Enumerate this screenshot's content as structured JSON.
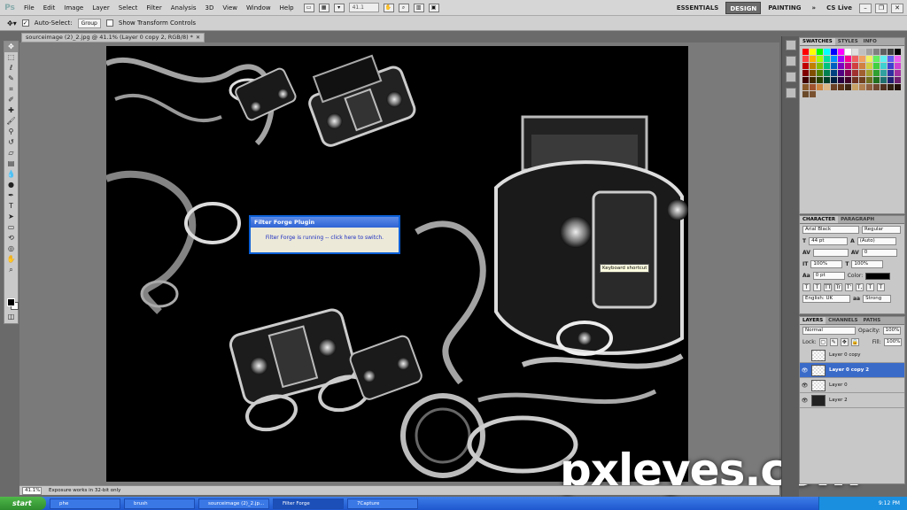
{
  "menubar": {
    "logo": "Ps",
    "items": [
      "File",
      "Edit",
      "Image",
      "Layer",
      "Select",
      "Filter",
      "Analysis",
      "3D",
      "View",
      "Window",
      "Help"
    ],
    "zoom": "41.1",
    "workspaces": [
      "ESSENTIALS",
      "DESIGN",
      "PAINTING"
    ],
    "more": "»",
    "cslive": "CS Live"
  },
  "optbar": {
    "auto_select_label": "Auto-Select:",
    "auto_select_value": "Group",
    "transform_label": "Show Transform Controls"
  },
  "document": {
    "tab_title": "sourceimage (2)_2.jpg @ 41.1% (Layer 0 copy 2, RGB/8) *",
    "status_zoom": "41.1%",
    "status_info": "Exposure works in 32-bit only"
  },
  "dialog": {
    "title": "Filter Forge Plugin",
    "message": "Filter Forge is running -- click here to switch."
  },
  "tooltip": "Keyboard shortcut",
  "watermark": "pxleyes.com",
  "swatches_panel": {
    "tabs": [
      "SWATCHES",
      "STYLES",
      "INFO"
    ],
    "colors": [
      "#ff0000",
      "#ffff00",
      "#00ff00",
      "#00ffff",
      "#0000ff",
      "#ff00ff",
      "#ffffff",
      "#e0e0e0",
      "#c0c0c0",
      "#a0a0a0",
      "#808080",
      "#606060",
      "#404040",
      "#000000",
      "#ff4040",
      "#ffb000",
      "#a0ff00",
      "#00e0a0",
      "#0090ff",
      "#a000ff",
      "#ff0090",
      "#f06060",
      "#f0a060",
      "#f0f060",
      "#60f060",
      "#60f0f0",
      "#6060f0",
      "#f060f0",
      "#c00000",
      "#c08000",
      "#80c000",
      "#00c080",
      "#0060c0",
      "#8000c0",
      "#c00080",
      "#d04040",
      "#d08040",
      "#d0d040",
      "#40d040",
      "#40d0d0",
      "#4040d0",
      "#d040d0",
      "#800000",
      "#805000",
      "#508000",
      "#008050",
      "#004080",
      "#500080",
      "#800050",
      "#a03030",
      "#a06030",
      "#a0a030",
      "#30a030",
      "#30a0a0",
      "#3030a0",
      "#a030a0",
      "#400000",
      "#402800",
      "#284000",
      "#004028",
      "#002040",
      "#280040",
      "#400028",
      "#703020",
      "#704020",
      "#707020",
      "#207020",
      "#207070",
      "#202070",
      "#702070",
      "#8b5a2b",
      "#a0522d",
      "#cd853f",
      "#deb887",
      "#6b4226",
      "#5c3317",
      "#3b2412",
      "#c8a165",
      "#b08050",
      "#906040",
      "#704830",
      "#503020",
      "#302010",
      "#201008",
      "#6b4a2a",
      "#7a5230"
    ]
  },
  "character_panel": {
    "tabs": [
      "CHARACTER",
      "PARAGRAPH"
    ],
    "font_family": "Arial Black",
    "font_style": "Regular",
    "font_size": "44 pt",
    "leading": "(Auto)",
    "kerning": "",
    "tracking": "0",
    "vertical_scale": "100%",
    "horizontal_scale": "100%",
    "baseline_shift": "0 pt",
    "color_label": "Color:",
    "style_buttons": [
      "T",
      "T",
      "TT",
      "Tr",
      "T'",
      "T,",
      "T",
      "T"
    ],
    "language": "English: UK",
    "antialias_icon": "aa",
    "antialias": "Strong"
  },
  "layers_panel": {
    "tabs": [
      "LAYERS",
      "CHANNELS",
      "PATHS"
    ],
    "blend_mode": "Normal",
    "opacity_label": "Opacity:",
    "opacity": "100%",
    "lock_label": "Lock:",
    "fill_label": "Fill:",
    "fill": "100%",
    "layers": [
      {
        "name": "Layer 0 copy",
        "visible": false,
        "thumb": "light",
        "selected": false
      },
      {
        "name": "Layer 0 copy 2",
        "visible": true,
        "thumb": "light",
        "selected": true
      },
      {
        "name": "Layer 0",
        "visible": true,
        "thumb": "light",
        "selected": false
      },
      {
        "name": "Layer 2",
        "visible": true,
        "thumb": "dark",
        "selected": false
      }
    ]
  },
  "taskbar": {
    "start": "start",
    "tasks": [
      "phe",
      "brush",
      "sourceimage (2)_2.jp...",
      "Filter Forge",
      "7Capture"
    ],
    "clock": "9:12 PM"
  }
}
